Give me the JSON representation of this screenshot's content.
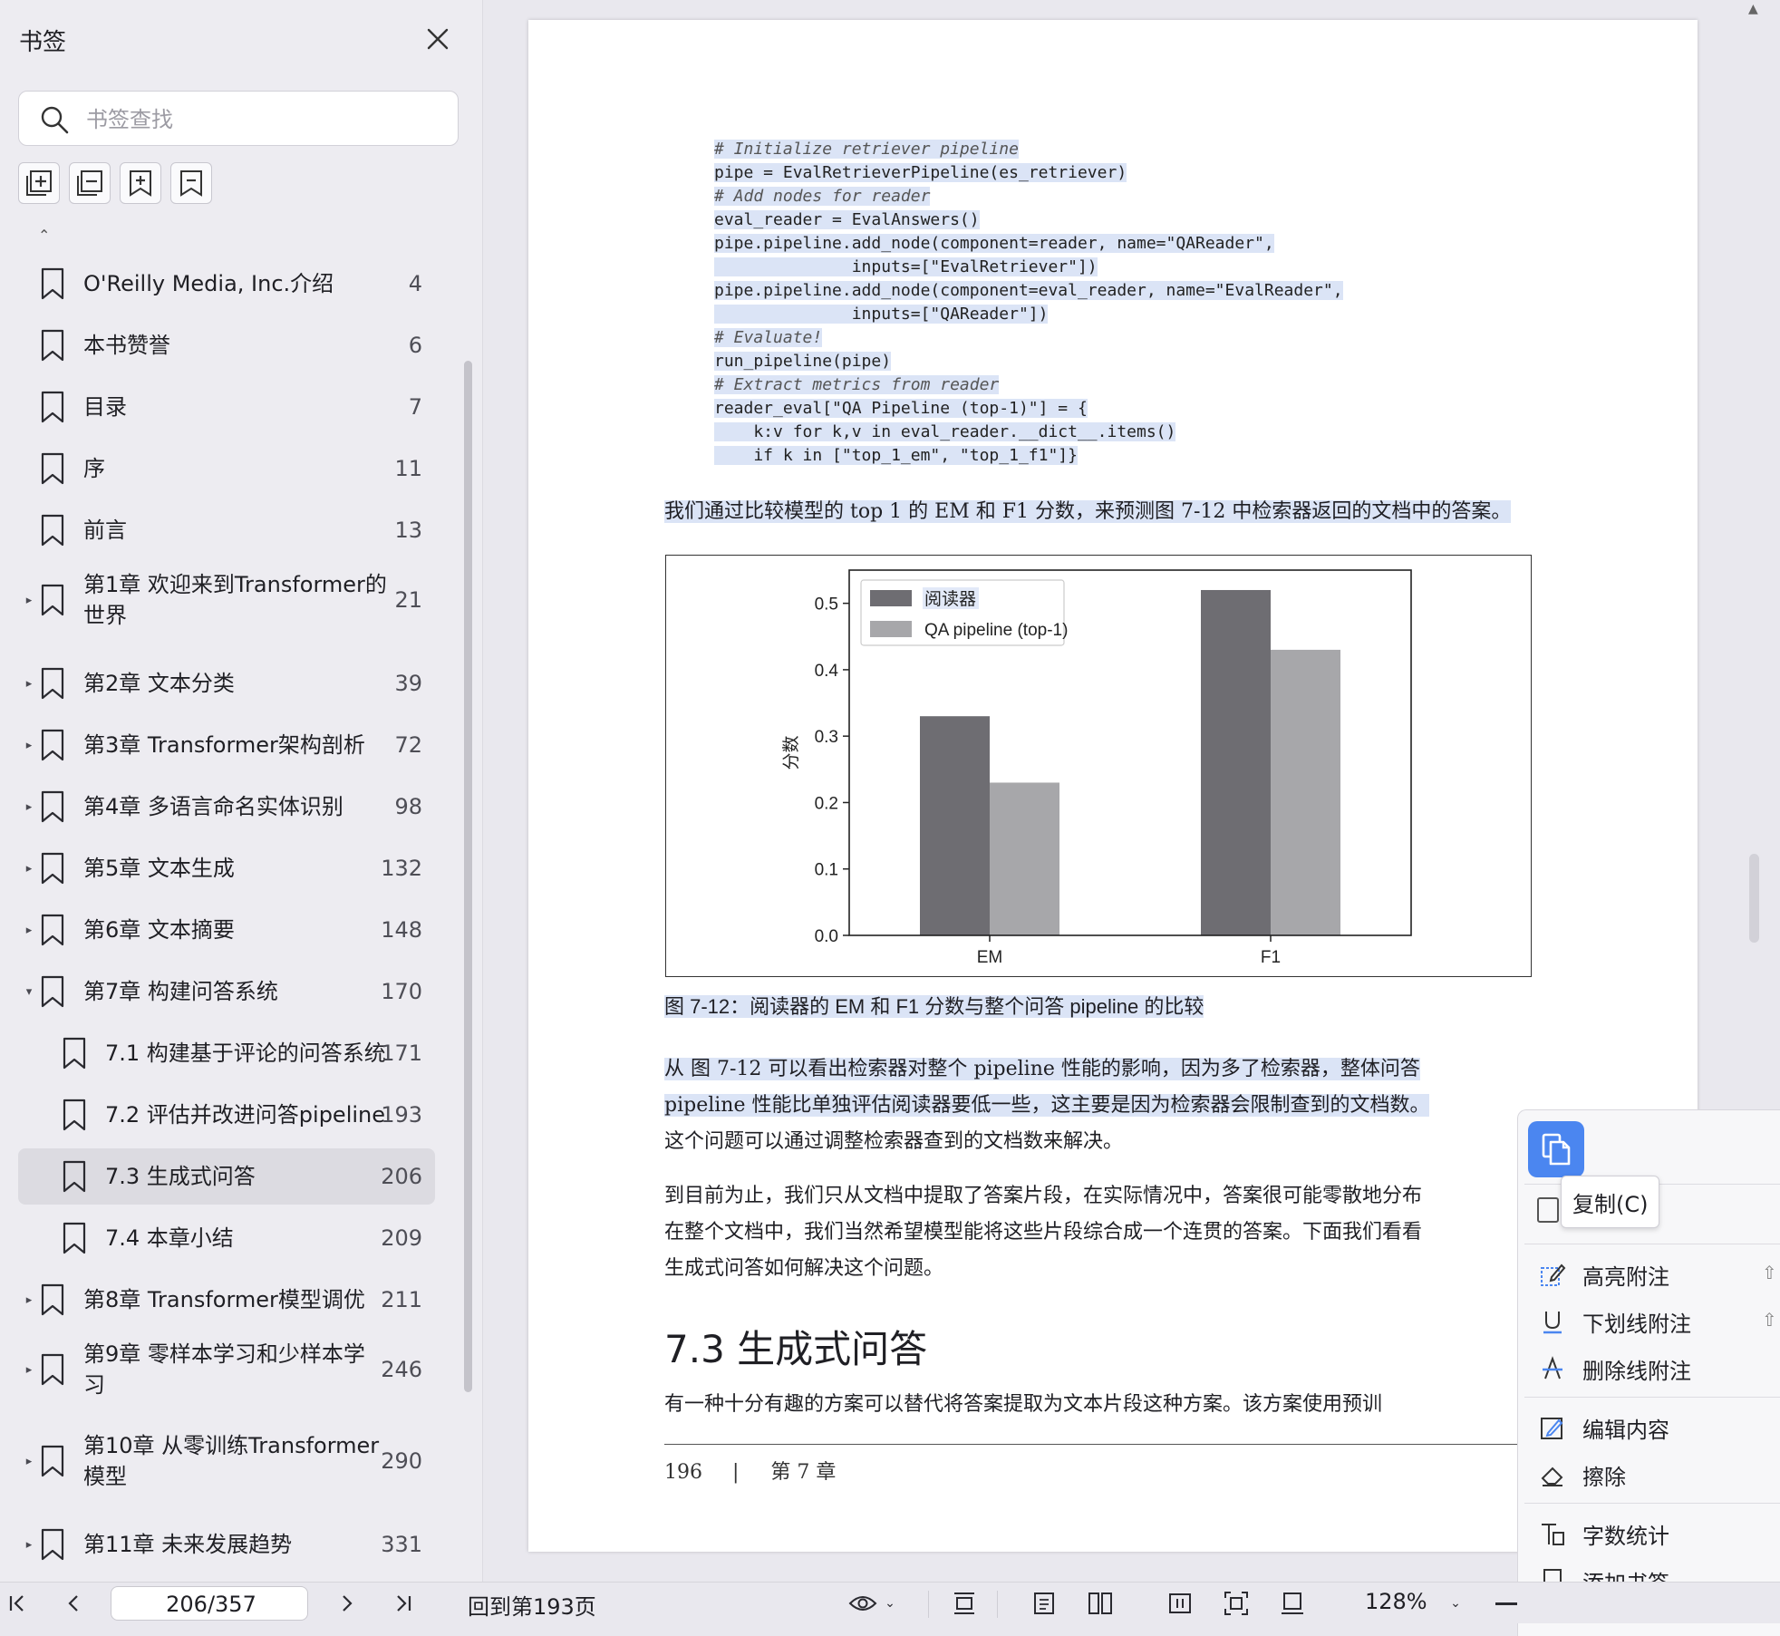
{
  "sidebar": {
    "title": "书签",
    "search_placeholder": "书签查找",
    "bookmarks": [
      {
        "label": "O'Reilly Media, Inc.介绍",
        "page": "4"
      },
      {
        "label": "本书赞誉",
        "page": "6"
      },
      {
        "label": "目录",
        "page": "7"
      },
      {
        "label": "序",
        "page": "11"
      },
      {
        "label": "前言",
        "page": "13"
      },
      {
        "label": "第1章 欢迎来到Transformer的",
        "label2": "世界",
        "page": "21"
      },
      {
        "label": "第2章 文本分类",
        "page": "39"
      },
      {
        "label": "第3章 Transformer架构剖析",
        "page": "72"
      },
      {
        "label": "第4章 多语言命名实体识别",
        "page": "98"
      },
      {
        "label": "第5章 文本生成",
        "page": "132"
      },
      {
        "label": "第6章 文本摘要",
        "page": "148"
      },
      {
        "label": "第7章 构建问答系统",
        "page": "170"
      },
      {
        "label": "7.1 构建基于评论的问答系统",
        "page": "171"
      },
      {
        "label": "7.2 评估并改进问答pipeline",
        "page": "193"
      },
      {
        "label": "7.3 生成式问答",
        "page": "206"
      },
      {
        "label": "7.4 本章小结",
        "page": "209"
      },
      {
        "label": "第8章 Transformer模型调优",
        "page": "211"
      },
      {
        "label": "第9章 零样本学习和少样本学",
        "label2": "习",
        "page": "246"
      },
      {
        "label": "第10章 从零训练Transformer",
        "label2": "模型",
        "page": "290"
      },
      {
        "label": "第11章 未来发展趋势",
        "page": "331"
      }
    ]
  },
  "document": {
    "code": [
      "# Initialize retriever pipeline",
      "pipe = EvalRetrieverPipeline(es_retriever)",
      "# Add nodes for reader",
      "eval_reader = EvalAnswers()",
      "pipe.pipeline.add_node(component=reader, name=\"QAReader\",",
      "              inputs=[\"EvalRetriever\"])",
      "pipe.pipeline.add_node(component=eval_reader, name=\"EvalReader\",",
      "              inputs=[\"QAReader\"])",
      "# Evaluate!",
      "run_pipeline(pipe)",
      "# Extract metrics from reader",
      "reader_eval[\"QA Pipeline (top-1)\"] = {",
      "    k:v for k,v in eval_reader.__dict__.items()",
      "    if k in [\"top_1_em\", \"top_1_f1\"]}"
    ],
    "para1": "我们通过比较模型的 top 1 的 EM 和 F1 分数，来预测图 7-12 中检索器返回的文档中的答案。",
    "figure_caption": "图 7-12：阅读器的 EM 和 F1 分数与整个问答 pipeline 的比较",
    "para2_lines": [
      "从 图 7-12 可以看出检索器对整个 pipeline 性能的影响，因为多了检索器，整体问答",
      "pipeline 性能比单独评估阅读器要低一些，这主要是因为检索器会限制查到的文档数。",
      "这个问题可以通过调整检索器查到的文档数来解决。"
    ],
    "para3_lines": [
      "到目前为止，我们只从文档中提取了答案片段，在实际情况中，答案很可能零散地分布",
      "在整个文档中，我们当然希望模型能将这些片段综合成一个连贯的答案。下面我们看看",
      "生成式问答如何解决这个问题。"
    ],
    "section_title": "7.3 生成式问答",
    "para4": "有一种十分有趣的方案可以替代将答案提取为文本片段这种方案。该方案使用预训",
    "footer_page": "196",
    "footer_sep": "|",
    "footer_chapter": "第 7 章"
  },
  "chart_data": {
    "type": "bar",
    "categories": [
      "EM",
      "F1"
    ],
    "series": [
      {
        "name": "阅读器",
        "values": [
          0.33,
          0.52
        ],
        "color": "#6e6d72"
      },
      {
        "name": "QA pipeline (top-1)",
        "values": [
          0.23,
          0.43
        ],
        "color": "#a7a7aa"
      }
    ],
    "ylabel": "分数",
    "xlabel": "",
    "title": "",
    "ylim": [
      0.0,
      0.55
    ],
    "yticks": [
      "0.0",
      "0.1",
      "0.2",
      "0.3",
      "0.4",
      "0.5"
    ],
    "ytick_values": [
      0,
      0.1,
      0.2,
      0.3,
      0.4,
      0.5
    ],
    "legend_position": "top-left",
    "grid": false
  },
  "context_menu": {
    "tooltip": "复制(C)",
    "items": [
      {
        "label": "高亮附注",
        "icon": "highlight-note-icon"
      },
      {
        "label": "下划线附注",
        "icon": "underline-icon"
      },
      {
        "label": "删除线附注",
        "icon": "strikethrough-icon"
      },
      {
        "label": "编辑内容",
        "icon": "edit-icon"
      },
      {
        "label": "擦除",
        "icon": "eraser-icon"
      },
      {
        "label": "字数统计",
        "icon": "word-count-icon"
      },
      {
        "label": "添加书签",
        "icon": "bookmark-add-icon"
      }
    ],
    "shift_glyph": "⇧"
  },
  "toolbar": {
    "page_value": "206/357",
    "back_label": "回到第193页",
    "zoom": "128%"
  },
  "colors": {
    "selection": "#dbe4f6",
    "accent": "#4b86f0"
  }
}
